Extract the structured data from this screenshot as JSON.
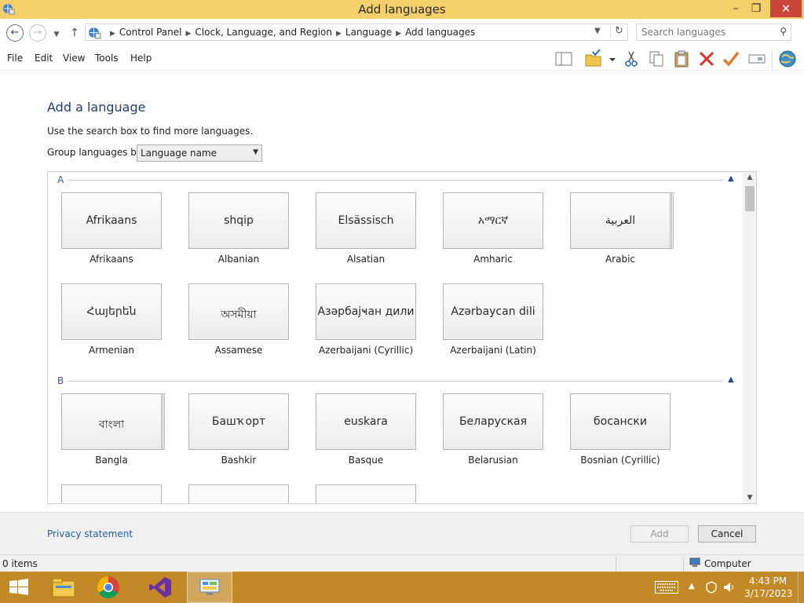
{
  "window": {
    "title": "Add languages",
    "controls": {
      "minimize": "–",
      "maximize": "❐",
      "close": "✕"
    }
  },
  "address": {
    "breadcrumbs": [
      "Control Panel",
      "Clock, Language, and Region",
      "Language",
      "Add languages"
    ],
    "search_placeholder": "Search languages"
  },
  "menu": [
    "File",
    "Edit",
    "View",
    "Tools",
    "Help"
  ],
  "toolbar_icons": [
    "layout-icon",
    "folder-options-icon",
    "dropdown-icon",
    "cut-icon",
    "copy-icon",
    "paste-icon",
    "delete-icon",
    "check-icon",
    "rename-icon",
    "globe-icon"
  ],
  "content": {
    "heading": "Add a language",
    "hint": "Use the search box to find more languages.",
    "group_label": "Group languages by:",
    "group_value": "Language name"
  },
  "groups": [
    {
      "letter": "A",
      "languages": [
        {
          "native": "Afrikaans",
          "name": "Afrikaans"
        },
        {
          "native": "shqip",
          "name": "Albanian"
        },
        {
          "native": "Elsässisch",
          "name": "Alsatian"
        },
        {
          "native": "አማርኛ",
          "name": "Amharic"
        },
        {
          "native": "العربية",
          "name": "Arabic"
        },
        {
          "native": "Հայերեն",
          "name": "Armenian"
        },
        {
          "native": "অসমীয়া",
          "name": "Assamese"
        },
        {
          "native": "Азәрбајҹан дили",
          "name": "Azerbaijani (Cyrillic)"
        },
        {
          "native": "Azərbaycan dili",
          "name": "Azerbaijani (Latin)"
        }
      ]
    },
    {
      "letter": "B",
      "languages": [
        {
          "native": "বাংলা",
          "name": "Bangla"
        },
        {
          "native": "Башҡорт",
          "name": "Bashkir"
        },
        {
          "native": "euskara",
          "name": "Basque"
        },
        {
          "native": "Беларуская",
          "name": "Belarusian"
        },
        {
          "native": "босански",
          "name": "Bosnian (Cyrillic)"
        }
      ]
    }
  ],
  "footer": {
    "privacy": "Privacy statement",
    "add": "Add",
    "cancel": "Cancel"
  },
  "status": {
    "items": "0 items",
    "location": "Computer"
  },
  "taskbar": {
    "time": "4:43 PM",
    "date": "3/17/2023",
    "apps": [
      "file-explorer-icon",
      "chrome-icon",
      "visual-studio-icon",
      "control-panel-icon"
    ]
  },
  "colors": {
    "title_bar": "#f4cf6a",
    "taskbar": "#c18a26",
    "heading": "#1e3f7a",
    "link": "#1f5fb0",
    "close_button": "#c9453a"
  }
}
